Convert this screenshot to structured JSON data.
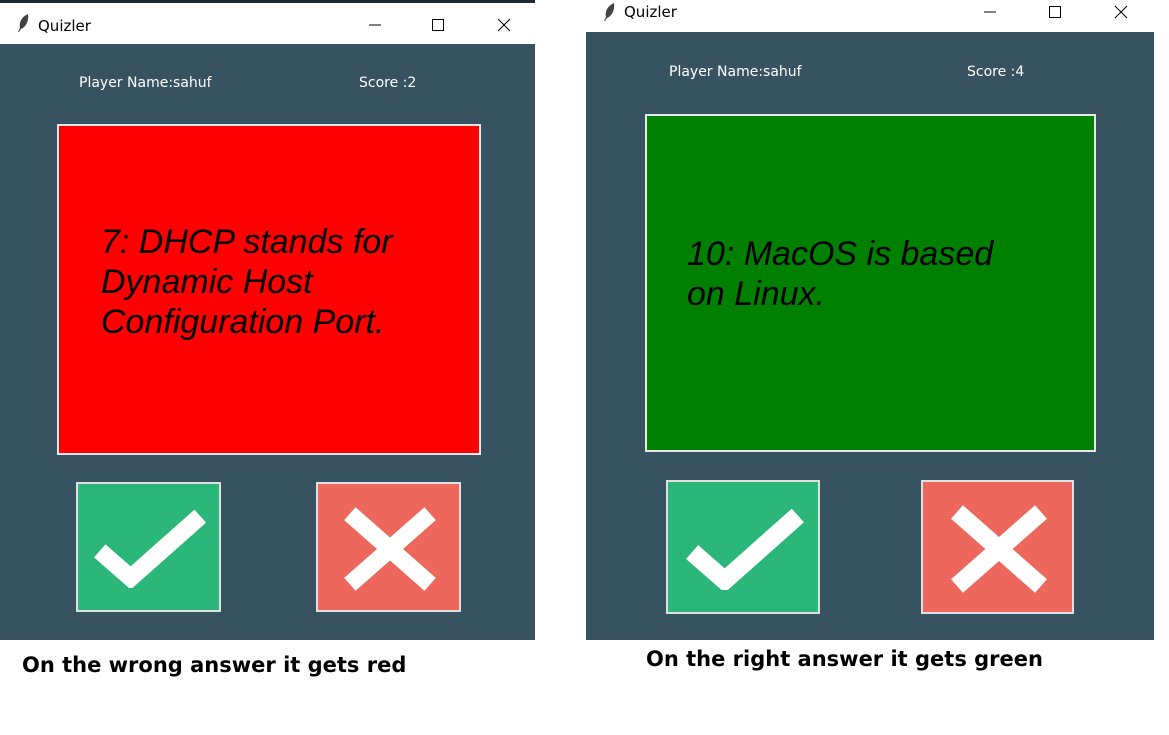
{
  "colors": {
    "window_bg": "#375362",
    "wrong_card": "#ff0000",
    "right_card": "#008000",
    "true_button": "#2bb77a",
    "false_button": "#ee675d"
  },
  "left_window": {
    "title": "Quizler",
    "player_label": "Player Name:sahuf",
    "score_label": "Score :2",
    "question": "7: DHCP stands for\nDynamic Host\nConfiguration Port.",
    "card_state": "wrong",
    "caption": "On the wrong answer it gets red"
  },
  "right_window": {
    "title": "Quizler",
    "player_label": "Player Name:sahuf",
    "score_label": "Score :4",
    "question": "10: MacOS is based\non Linux.",
    "card_state": "right",
    "caption": "On the right answer it gets green"
  },
  "icons": {
    "app": "feather-icon",
    "minimize": "minimize-icon",
    "maximize": "maximize-icon",
    "close": "close-icon",
    "true": "check-icon",
    "false": "cross-icon"
  }
}
